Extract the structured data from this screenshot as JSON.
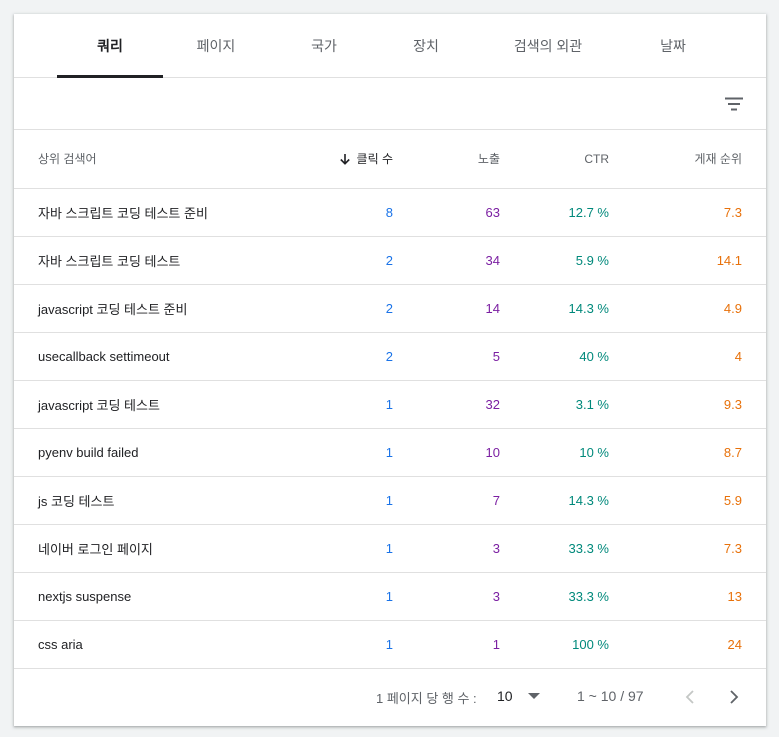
{
  "tabs": [
    {
      "label": "쿼리",
      "active": true
    },
    {
      "label": "페이지"
    },
    {
      "label": "국가"
    },
    {
      "label": "장치"
    },
    {
      "label": "검색의 외관"
    },
    {
      "label": "날짜"
    }
  ],
  "table": {
    "headers": {
      "query": "상위 검색어",
      "clicks": "클릭 수",
      "impressions": "노출",
      "ctr": "CTR",
      "position": "게재 순위"
    },
    "rows": [
      {
        "query": "자바 스크립트 코딩 테스트 준비",
        "clicks": "8",
        "impressions": "63",
        "ctr": "12.7 %",
        "position": "7.3"
      },
      {
        "query": "자바 스크립트 코딩 테스트",
        "clicks": "2",
        "impressions": "34",
        "ctr": "5.9 %",
        "position": "14.1"
      },
      {
        "query": "javascript 코딩 테스트 준비",
        "clicks": "2",
        "impressions": "14",
        "ctr": "14.3 %",
        "position": "4.9"
      },
      {
        "query": "usecallback settimeout",
        "clicks": "2",
        "impressions": "5",
        "ctr": "40 %",
        "position": "4"
      },
      {
        "query": "javascript 코딩 테스트",
        "clicks": "1",
        "impressions": "32",
        "ctr": "3.1 %",
        "position": "9.3"
      },
      {
        "query": "pyenv build failed",
        "clicks": "1",
        "impressions": "10",
        "ctr": "10 %",
        "position": "8.7"
      },
      {
        "query": "js 코딩 테스트",
        "clicks": "1",
        "impressions": "7",
        "ctr": "14.3 %",
        "position": "5.9"
      },
      {
        "query": "네이버 로그인 페이지",
        "clicks": "1",
        "impressions": "3",
        "ctr": "33.3 %",
        "position": "7.3"
      },
      {
        "query": "nextjs suspense",
        "clicks": "1",
        "impressions": "3",
        "ctr": "33.3 %",
        "position": "13"
      },
      {
        "query": "css aria",
        "clicks": "1",
        "impressions": "1",
        "ctr": "100 %",
        "position": "24"
      }
    ]
  },
  "footer": {
    "rows_per_page_label": "1 페이지 당 행 수 :",
    "rows_per_page_value": "10",
    "range": "1 ~ 10 / 97"
  },
  "icons": {
    "filter": "filter-list-icon",
    "sort": "arrow-down-icon",
    "prev": "chevron-left-icon",
    "next": "chevron-right-icon",
    "dropdown": "caret-down-icon"
  },
  "colors": {
    "clicks": "#1a73e8",
    "impressions": "#7b1fa2",
    "ctr": "#00897b",
    "position": "#e8710a"
  }
}
